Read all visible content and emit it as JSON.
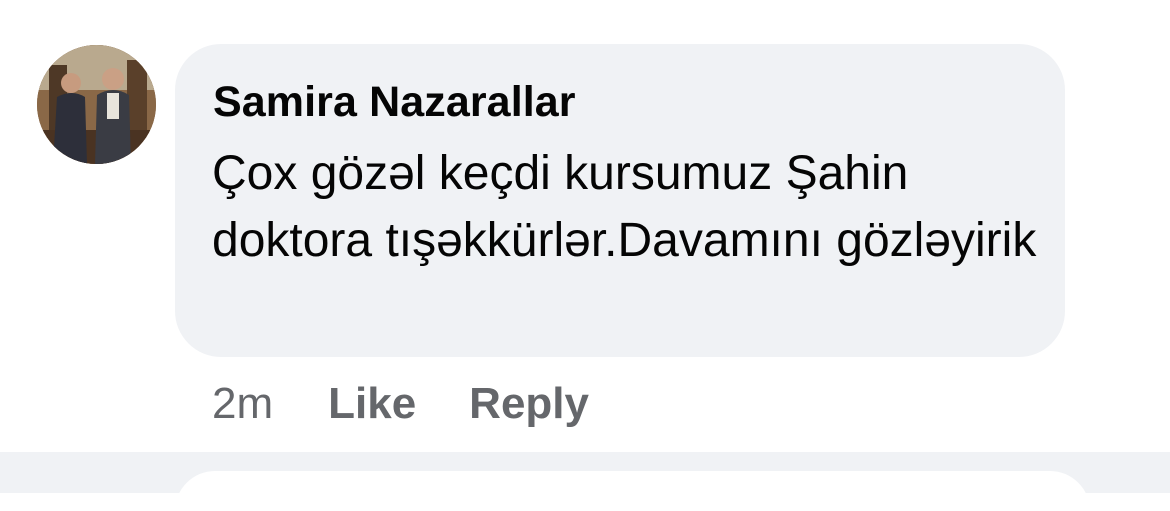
{
  "comment": {
    "author": "Samira Nazarallar",
    "text": "Çox gözəl keçdi kursumuz Şahin doktora tışəkkürlər.Davamını gözləyirik",
    "time": "2m",
    "like_label": "Like",
    "reply_label": "Reply",
    "avatar_icon": "user-avatar-photo"
  },
  "colors": {
    "bubble": "#f0f2f5",
    "text": "#050505",
    "meta": "#65676b",
    "divider": "#f0f2f5"
  }
}
